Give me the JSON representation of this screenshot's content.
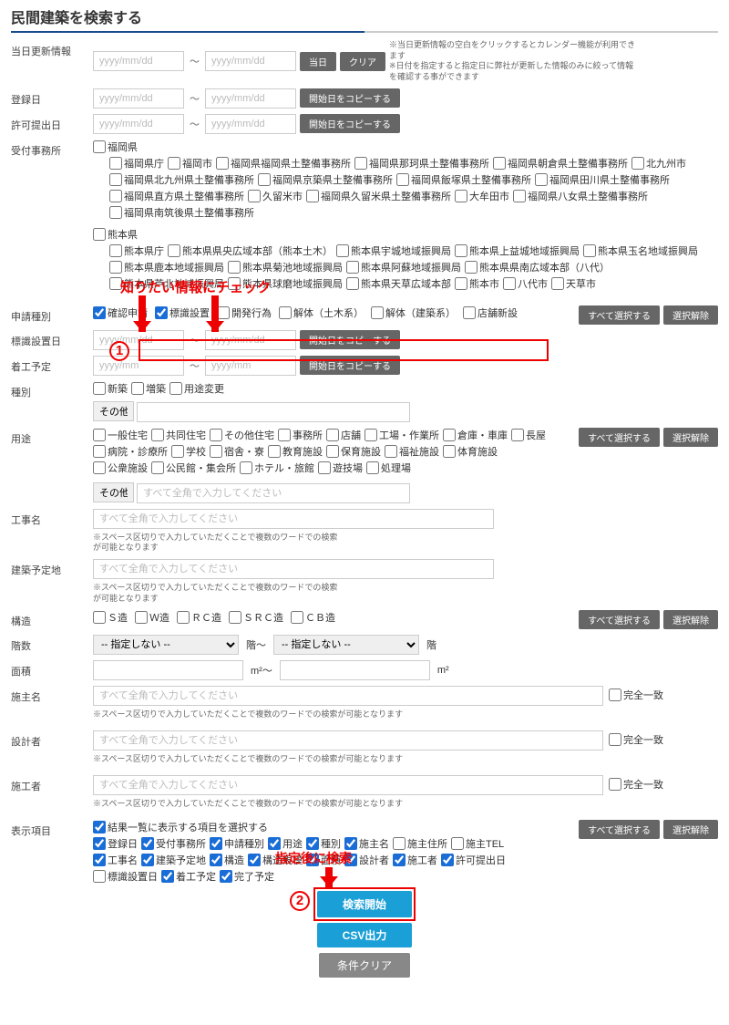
{
  "page_title": "民間建築を検索する",
  "annotations": {
    "check_label": "知りたい情報にチェック",
    "search_label": "指定後に検索",
    "circled1": "1",
    "circled2": "2"
  },
  "rows": {
    "update_date": {
      "label": "当日更新情報",
      "placeholder": "yyyy/mm/dd",
      "btn_today": "当日",
      "btn_clear": "クリア",
      "hint": "※当日更新情報の空白をクリックするとカレンダー機能が利用できます\n※日付を指定すると指定日に弊社が更新した情報のみに絞って情報を確認する事ができます"
    },
    "reg_date": {
      "label": "登録日",
      "placeholder": "yyyy/mm/dd",
      "btn": "開始日をコピーする"
    },
    "permit_date": {
      "label": "許可提出日",
      "placeholder": "yyyy/mm/dd",
      "btn": "開始日をコピーする"
    },
    "office": {
      "label": "受付事務所",
      "fukuoka": "福岡県",
      "fukuoka_items": [
        "福岡県庁",
        "福岡市",
        "福岡県福岡県土整備事務所",
        "福岡県那珂県土整備事務所",
        "福岡県朝倉県土整備事務所",
        "北九州市",
        "福岡県北九州県土整備事務所",
        "福岡県京築県土整備事務所",
        "福岡県飯塚県土整備事務所",
        "福岡県田川県土整備事務所",
        "福岡県直方県土整備事務所",
        "久留米市",
        "福岡県久留米県土整備事務所",
        "大牟田市",
        "福岡県八女県土整備事務所",
        "福岡県南筑後県土整備事務所"
      ],
      "kumamoto": "熊本県",
      "kumamoto_items": [
        "熊本県庁",
        "熊本県県央広域本部（熊本土木）",
        "熊本県宇城地域振興局",
        "熊本県上益城地域振興局",
        "熊本県玉名地域振興局",
        "熊本県鹿本地域振興局",
        "熊本県菊池地域振興局",
        "熊本県阿蘇地域振興局",
        "熊本県県南広域本部（八代）",
        "熊本県芦北地域振興局",
        "熊本県球磨地域振興局",
        "熊本県天草広域本部",
        "熊本市",
        "八代市",
        "天草市"
      ]
    },
    "app_type": {
      "label": "申請種別",
      "items": [
        "確認申請",
        "標識設置",
        "開発行為",
        "解体（土木系）",
        "解体（建築系）",
        "店舗新設"
      ],
      "checked": [
        0,
        1
      ],
      "btn_all": "すべて選択する",
      "btn_clear": "選択解除"
    },
    "sign_date": {
      "label": "標識設置日",
      "placeholder": "yyyy/mm/dd",
      "btn": "開始日をコピーする"
    },
    "start_date": {
      "label": "着工予定",
      "placeholder": "yyyy/mm",
      "btn": "開始日をコピーする"
    },
    "kind": {
      "label": "種別",
      "items": [
        "新築",
        "増築",
        "用途変更"
      ],
      "sonota": "その他"
    },
    "usage": {
      "label": "用途",
      "row1": [
        "一般住宅",
        "共同住宅",
        "その他住宅",
        "事務所",
        "店舗",
        "工場・作業所",
        "倉庫・車庫",
        "長屋"
      ],
      "row2": [
        "病院・診療所",
        "学校",
        "宿舎・寮",
        "教育施設",
        "保育施設",
        "福祉施設",
        "体育施設"
      ],
      "row3": [
        "公衆施設",
        "公民館・集会所",
        "ホテル・旅館",
        "遊技場",
        "処理場"
      ],
      "sonota": "その他",
      "sonota_ph": "すべて全角で入力してください",
      "btn_all": "すべて選択する",
      "btn_clear": "選択解除"
    },
    "work_name": {
      "label": "工事名",
      "placeholder": "すべて全角で入力してください",
      "hint": "※スペース区切りで入力していただくことで複数のワードでの検索が可能となります"
    },
    "build_site": {
      "label": "建築予定地",
      "placeholder": "すべて全角で入力してください",
      "hint": "※スペース区切りで入力していただくことで複数のワードでの検索が可能となります"
    },
    "structure": {
      "label": "構造",
      "items": [
        "Ｓ造",
        "Ｗ造",
        "ＲＣ造",
        "ＳＲＣ造",
        "ＣＢ造"
      ],
      "btn_all": "すべて選択する",
      "btn_clear": "選択解除"
    },
    "floors": {
      "label": "階数",
      "opt": "-- 指定しない --",
      "unit_from": "階～",
      "unit_to": "階"
    },
    "area": {
      "label": "面積",
      "unit_from": "m²～",
      "unit_to": "m²"
    },
    "owner": {
      "label": "施主名",
      "placeholder": "すべて全角で入力してください",
      "exact": "完全一致",
      "hint": "※スペース区切りで入力していただくことで複数のワードでの検索が可能となります"
    },
    "designer": {
      "label": "設計者",
      "placeholder": "すべて全角で入力してください",
      "exact": "完全一致",
      "hint": "※スペース区切りで入力していただくことで複数のワードでの検索が可能となります"
    },
    "contractor": {
      "label": "施工者",
      "placeholder": "すべて全角で入力してください",
      "exact": "完全一致",
      "hint": "※スペース区切りで入力していただくことで複数のワードでの検索が可能となります"
    },
    "display": {
      "label": "表示項目",
      "head": "結果一覧に表示する項目を選択する",
      "row1": [
        "登録日",
        "受付事務所",
        "申請種別",
        "用途",
        "種別",
        "施主名",
        "施主住所",
        "施主TEL"
      ],
      "row1_checked": [
        0,
        1,
        2,
        3,
        4,
        5
      ],
      "row2": [
        "工事名",
        "建築予定地",
        "構造",
        "構造規模",
        "面積",
        "設計者",
        "施工者",
        "許可提出日"
      ],
      "row2_checked": [
        0,
        1,
        2,
        3,
        4,
        5,
        6,
        7
      ],
      "row3": [
        "標識設置日",
        "着工予定",
        "完了予定"
      ],
      "row3_checked": [
        1,
        2
      ],
      "btn_all": "すべて選択する",
      "btn_clear": "選択解除"
    },
    "actions": {
      "search": "検索開始",
      "csv": "CSV出力",
      "clear": "条件クリア"
    }
  }
}
